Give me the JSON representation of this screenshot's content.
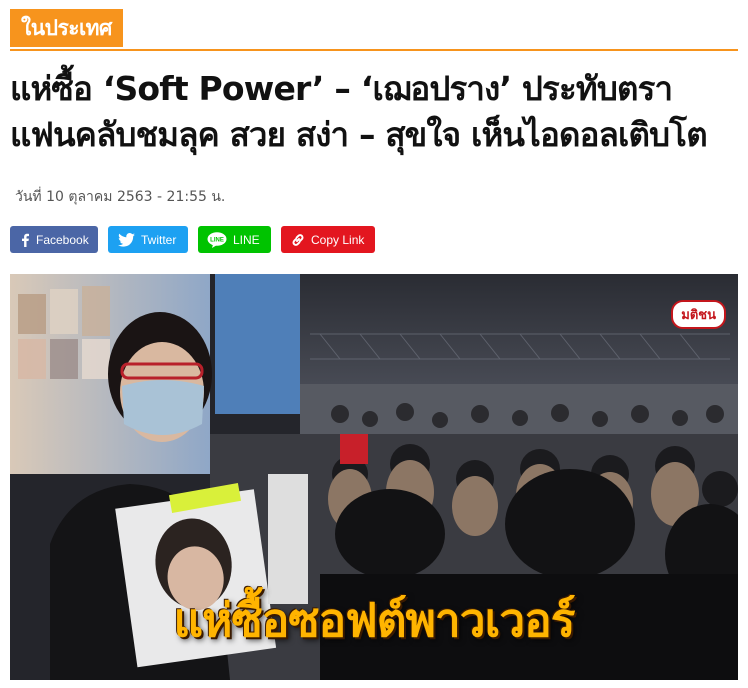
{
  "category": {
    "label": "ในประเทศ",
    "color": "#f7941d"
  },
  "article": {
    "title": "แห่ซื้อ ‘Soft Power’ – ‘เฌอปราง’ ประทับตรา แฟนคลับชมลุค สวย สง่า – สุขใจ เห็นไอดอลเติบโต",
    "date": "วันที่ 10 ตุลาคม 2563 - 21:55 น."
  },
  "share": {
    "facebook": {
      "label": "Facebook",
      "icon": "facebook-icon",
      "color": "#4b66a6"
    },
    "twitter": {
      "label": "Twitter",
      "icon": "twitter-icon",
      "color": "#1da1f2"
    },
    "line": {
      "label": "LINE",
      "icon": "line-icon",
      "color": "#00c300"
    },
    "copy": {
      "label": "Copy Link",
      "icon": "link-icon",
      "color": "#e3161f"
    }
  },
  "photo": {
    "watermark": "มติชน",
    "overlay_text": "แห่ซื้อซอฟต์พาวเวอร์"
  }
}
